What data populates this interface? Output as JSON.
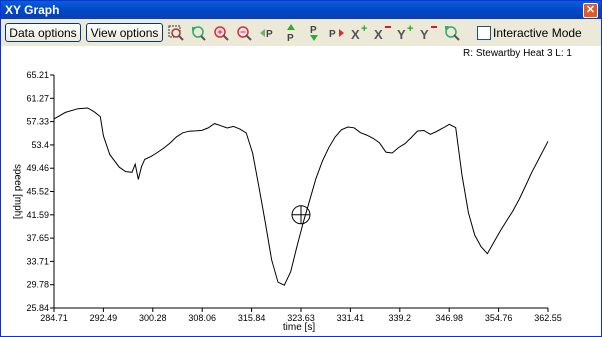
{
  "window": {
    "title": "XY Graph",
    "close_glyph": "✕"
  },
  "toolbar": {
    "data_options_label": "Data options",
    "view_options_label": "View options",
    "icons": [
      "zoom-box-icon",
      "zoom-reset-icon",
      "zoom-in-icon",
      "zoom-out-icon",
      "prev-point-icon",
      "marker-up-icon",
      "marker-down-icon",
      "next-point-icon",
      "x-add-icon",
      "x-remove-icon",
      "y-add-icon",
      "y-remove-icon",
      "refresh-icon"
    ],
    "interactive_mode_label": "Interactive Mode",
    "interactive_mode_checked": false
  },
  "info_text": "R: Stewartby Heat 3  L: 1",
  "chart_data": {
    "type": "line",
    "xlabel": "time [s]",
    "ylabel": "speed [mph]",
    "xlim": [
      284.71,
      362.55
    ],
    "ylim": [
      25.84,
      65.21
    ],
    "x_ticks": [
      "284.71",
      "292.49",
      "300.28",
      "308.06",
      "315.84",
      "323.63",
      "331.41",
      "339.2",
      "346.98",
      "354.76",
      "362.55"
    ],
    "y_ticks": [
      "65.21",
      "61.27",
      "57.33",
      "53.4",
      "49.46",
      "45.52",
      "41.59",
      "37.65",
      "33.71",
      "29.78",
      "25.84"
    ],
    "series": [
      {
        "x": [
          284.71,
          286.5,
          288.5,
          290.0,
          291.0,
          292.0,
          292.5,
          293.5,
          295.0,
          296.0,
          297.0,
          297.5,
          298.0,
          298.5,
          299.0,
          300.0,
          301.0,
          302.0,
          303.0,
          304.0,
          305.0,
          306.0,
          307.0,
          308.0,
          309.0,
          310.0,
          311.0,
          312.0,
          313.0,
          314.0,
          315.0,
          316.0,
          317.0,
          318.0,
          319.0,
          320.0,
          321.0,
          322.0,
          323.0,
          324.0,
          325.0,
          326.0,
          327.0,
          328.0,
          329.0,
          330.0,
          331.0,
          332.0,
          333.0,
          334.0,
          335.0,
          336.0,
          337.0,
          338.0,
          339.0,
          340.0,
          341.0,
          342.0,
          343.0,
          344.0,
          345.0,
          346.0,
          347.0,
          348.0,
          349.0,
          350.0,
          351.0,
          352.0,
          353.0,
          354.0,
          355.0,
          356.0,
          357.0,
          358.0,
          359.0,
          360.0,
          361.0,
          362.55
        ],
        "y": [
          57.8,
          58.6,
          59.2,
          59.6,
          59.3,
          58.5,
          55.0,
          51.5,
          49.3,
          48.8,
          49.0,
          50.5,
          47.7,
          49.5,
          50.6,
          51.3,
          52.3,
          53.2,
          53.9,
          54.6,
          55.1,
          55.5,
          55.9,
          56.2,
          56.5,
          56.9,
          56.3,
          56.0,
          56.6,
          56.4,
          55.7,
          52.0,
          46.0,
          40.0,
          34.0,
          30.5,
          30.0,
          32.0,
          36.0,
          40.0,
          44.0,
          48.0,
          51.0,
          53.0,
          54.5,
          55.6,
          56.3,
          56.5,
          55.8,
          55.2,
          54.3,
          53.4,
          52.0,
          52.2,
          53.3,
          53.8,
          54.5,
          55.4,
          55.6,
          55.3,
          56.0,
          56.5,
          56.8,
          56.0,
          48.0,
          42.0,
          38.5,
          36.5,
          35.0,
          36.6,
          38.5,
          40.5,
          42.5,
          44.5,
          46.5,
          48.5,
          50.5,
          54.0
        ]
      }
    ],
    "marker": {
      "x": 323.63,
      "y": 41.59
    },
    "colors": {
      "line": "#000000",
      "axis": "#000000",
      "background": "#ffffff"
    }
  }
}
